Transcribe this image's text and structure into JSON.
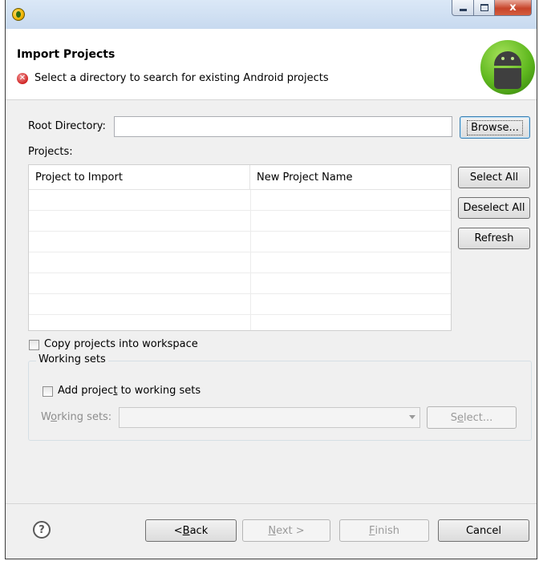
{
  "window": {
    "minimize_icon": "minimize-icon",
    "maximize_icon": "maximize-icon",
    "close_icon": "close-icon",
    "close_glyph": "x"
  },
  "header": {
    "title": "Import Projects",
    "message": "Select a directory to search for existing Android projects",
    "message_icon": "error-icon",
    "logo_icon": "android-logo-icon"
  },
  "root_directory": {
    "label": "Root Directory:",
    "value": "",
    "browse_label": "Browse..."
  },
  "projects": {
    "label": "Projects:",
    "columns": [
      "Project to Import",
      "New Project Name"
    ],
    "rows": [
      [
        "",
        ""
      ],
      [
        "",
        ""
      ],
      [
        "",
        ""
      ],
      [
        "",
        ""
      ],
      [
        "",
        ""
      ],
      [
        "",
        ""
      ],
      [
        "",
        ""
      ]
    ],
    "select_all_label": "Select All",
    "deselect_all_label": "Deselect All",
    "refresh_label": "Refresh"
  },
  "copy_option": {
    "label": "Copy projects into workspace",
    "checked": false
  },
  "working_sets": {
    "group_title": "Working sets",
    "add_label_pre": "Add projec",
    "add_label_mnemonic": "t",
    "add_label_post": " to working sets",
    "add_checked": false,
    "field_label_pre": "W",
    "field_label_mnemonic": "o",
    "field_label_post": "rking sets:",
    "field_value": "",
    "select_label_pre": "S",
    "select_label_mnemonic": "e",
    "select_label_post": "lect..."
  },
  "footer": {
    "help_icon": "help-icon",
    "back_pre": "< ",
    "back_mnemonic": "B",
    "back_post": "ack",
    "next_mnemonic": "N",
    "next_post": "ext >",
    "finish_mnemonic": "F",
    "finish_post": "inish",
    "cancel_label": "Cancel"
  }
}
